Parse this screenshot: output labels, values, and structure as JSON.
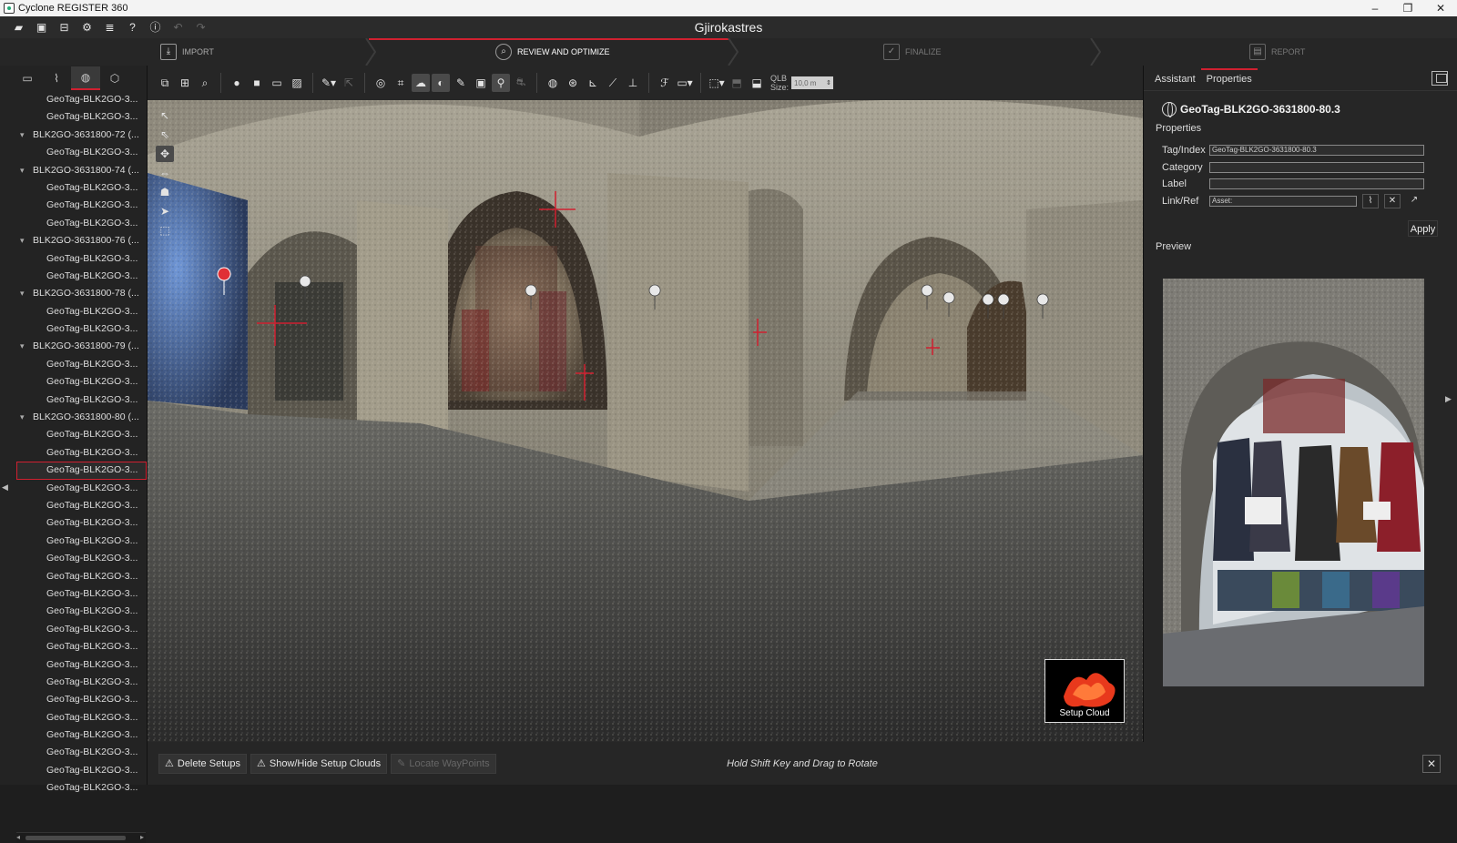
{
  "window": {
    "title": "Cyclone REGISTER 360",
    "controls": [
      "–",
      "❐",
      "✕"
    ]
  },
  "project": {
    "name": "Gjirokastres"
  },
  "workflow": {
    "steps": [
      {
        "label": "IMPORT"
      },
      {
        "label": "REVIEW AND OPTIMIZE"
      },
      {
        "label": "FINALIZE"
      },
      {
        "label": "REPORT"
      }
    ],
    "active_index": 1
  },
  "tree": {
    "items": [
      {
        "label": "GeoTag-BLK2GO-3...",
        "type": "child"
      },
      {
        "label": "GeoTag-BLK2GO-3...",
        "type": "child"
      },
      {
        "label": "BLK2GO-3631800-72 (...",
        "type": "parent"
      },
      {
        "label": "GeoTag-BLK2GO-3...",
        "type": "child"
      },
      {
        "label": "BLK2GO-3631800-74 (...",
        "type": "parent"
      },
      {
        "label": "GeoTag-BLK2GO-3...",
        "type": "child"
      },
      {
        "label": "GeoTag-BLK2GO-3...",
        "type": "child"
      },
      {
        "label": "GeoTag-BLK2GO-3...",
        "type": "child"
      },
      {
        "label": "BLK2GO-3631800-76 (...",
        "type": "parent"
      },
      {
        "label": "GeoTag-BLK2GO-3...",
        "type": "child"
      },
      {
        "label": "GeoTag-BLK2GO-3...",
        "type": "child"
      },
      {
        "label": "BLK2GO-3631800-78 (...",
        "type": "parent"
      },
      {
        "label": "GeoTag-BLK2GO-3...",
        "type": "child"
      },
      {
        "label": "GeoTag-BLK2GO-3...",
        "type": "child"
      },
      {
        "label": "BLK2GO-3631800-79 (...",
        "type": "parent"
      },
      {
        "label": "GeoTag-BLK2GO-3...",
        "type": "child"
      },
      {
        "label": "GeoTag-BLK2GO-3...",
        "type": "child"
      },
      {
        "label": "GeoTag-BLK2GO-3...",
        "type": "child"
      },
      {
        "label": "BLK2GO-3631800-80 (...",
        "type": "parent"
      },
      {
        "label": "GeoTag-BLK2GO-3...",
        "type": "child"
      },
      {
        "label": "GeoTag-BLK2GO-3...",
        "type": "child"
      },
      {
        "label": "GeoTag-BLK2GO-3...",
        "type": "child",
        "selected": true
      },
      {
        "label": "GeoTag-BLK2GO-3...",
        "type": "child"
      },
      {
        "label": "GeoTag-BLK2GO-3...",
        "type": "child"
      },
      {
        "label": "GeoTag-BLK2GO-3...",
        "type": "child"
      },
      {
        "label": "GeoTag-BLK2GO-3...",
        "type": "child"
      },
      {
        "label": "GeoTag-BLK2GO-3...",
        "type": "child"
      },
      {
        "label": "GeoTag-BLK2GO-3...",
        "type": "child"
      },
      {
        "label": "GeoTag-BLK2GO-3...",
        "type": "child"
      },
      {
        "label": "GeoTag-BLK2GO-3...",
        "type": "child"
      },
      {
        "label": "GeoTag-BLK2GO-3...",
        "type": "child"
      },
      {
        "label": "GeoTag-BLK2GO-3...",
        "type": "child"
      },
      {
        "label": "GeoTag-BLK2GO-3...",
        "type": "child"
      },
      {
        "label": "GeoTag-BLK2GO-3...",
        "type": "child"
      },
      {
        "label": "GeoTag-BLK2GO-3...",
        "type": "child"
      },
      {
        "label": "GeoTag-BLK2GO-3...",
        "type": "child"
      },
      {
        "label": "GeoTag-BLK2GO-3...",
        "type": "child"
      },
      {
        "label": "GeoTag-BLK2GO-3...",
        "type": "child"
      },
      {
        "label": "GeoTag-BLK2GO-3...",
        "type": "child"
      },
      {
        "label": "GeoTag-BLK2GO-3...",
        "type": "child"
      }
    ]
  },
  "toolbar": {
    "qlb_label": "QLB",
    "size_label": "Size:",
    "size_value": "10,0 m"
  },
  "viewport": {
    "setup_thumb_label": "Setup Cloud"
  },
  "bottom": {
    "delete_setups": "Delete Setups",
    "show_hide_setup_clouds": "Show/Hide Setup Clouds",
    "locate_waypoints": "Locate WayPoints",
    "hint": "Hold Shift Key and Drag to Rotate"
  },
  "right_panel": {
    "tabs": [
      "Assistant",
      "Properties"
    ],
    "active_tab": 1,
    "title": "GeoTag-BLK2GO-3631800-80.3",
    "properties_heading": "Properties",
    "fields": {
      "tag_index_label": "Tag/Index",
      "tag_index_value": "GeoTag-BLK2GO-3631800-80.3",
      "category_label": "Category",
      "category_value": "",
      "label_label": "Label",
      "label_value": "",
      "link_ref_label": "Link/Ref",
      "link_ref_value": "Asset:"
    },
    "apply": "Apply",
    "preview_heading": "Preview"
  },
  "colors": {
    "accent": "#d02030",
    "panel": "#262626",
    "tree_bg": "#232323"
  }
}
